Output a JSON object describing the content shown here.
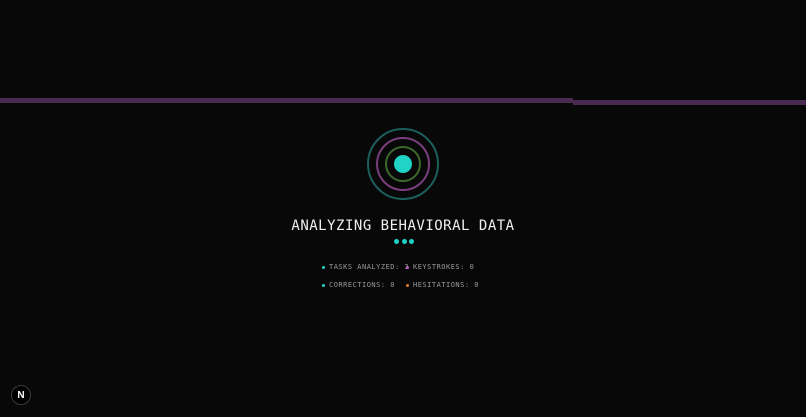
{
  "status": {
    "title": "ANALYZING BEHAVIORAL DATA"
  },
  "stats": [
    {
      "label": "TASKS ANALYZED",
      "value": "3",
      "text": "TASKS ANALYZED: 3",
      "color": "#1fd3c6"
    },
    {
      "label": "KEYSTROKES",
      "value": "0",
      "text": "KEYSTROKES: 0",
      "color": "#b85bbd"
    },
    {
      "label": "CORRECTIONS",
      "value": "0",
      "text": "CORRECTIONS: 0",
      "color": "#1fd3c6"
    },
    {
      "label": "HESITATIONS",
      "value": "0",
      "text": "HESITATIONS: 0",
      "color": "#e07a2a"
    }
  ],
  "colors": {
    "accent": "#1fd3c6",
    "stripe": "#4b2a52",
    "ring_outer": "#1c5f5a",
    "ring_mid": "#7a3e7c",
    "ring_inner": "#3c6a2e",
    "background": "#080808"
  },
  "nav_badge": {
    "glyph": "N",
    "icon": "nextjs-logo-icon"
  }
}
